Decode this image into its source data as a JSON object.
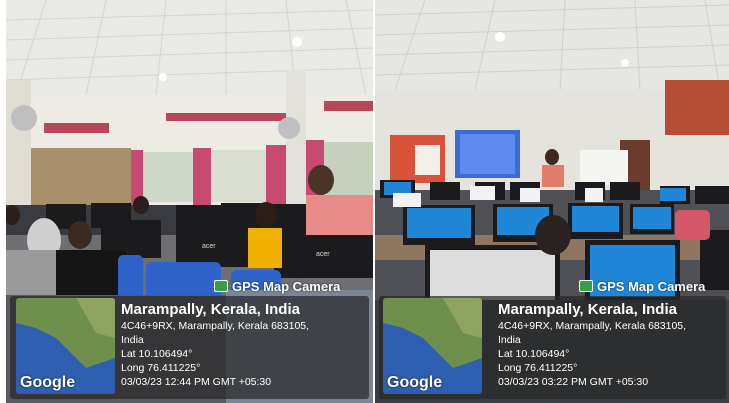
{
  "photos": [
    {
      "camera_label": "GPS Map Camera",
      "place": "Marampally, Kerala, India",
      "address": "4C46+9RX, Marampally, Kerala 683105,",
      "country": "India",
      "lat": "Lat 10.106494°",
      "long": "Long 76.411225°",
      "datetime": "03/03/23 12:44 PM GMT +05:30",
      "map_brand": "Google"
    },
    {
      "camera_label": "GPS Map Camera",
      "place": "Marampally, Kerala, India",
      "address": "4C46+9RX, Marampally, Kerala 683105,",
      "country": "India",
      "lat": "Lat 10.106494°",
      "long": "Long 76.411225°",
      "datetime": "03/03/23 03:22 PM GMT +05:30",
      "map_brand": "Google"
    }
  ],
  "monitor_brand": "acer",
  "colors": {
    "ceiling": "#e9e9e6",
    "wall": "#ecebe4",
    "curtain": "#c84a72",
    "monitor": "#1b1b1d",
    "chair": "#2f63c9",
    "screen_blue": "#1f86d8",
    "overlay": "#2d2d2d"
  }
}
